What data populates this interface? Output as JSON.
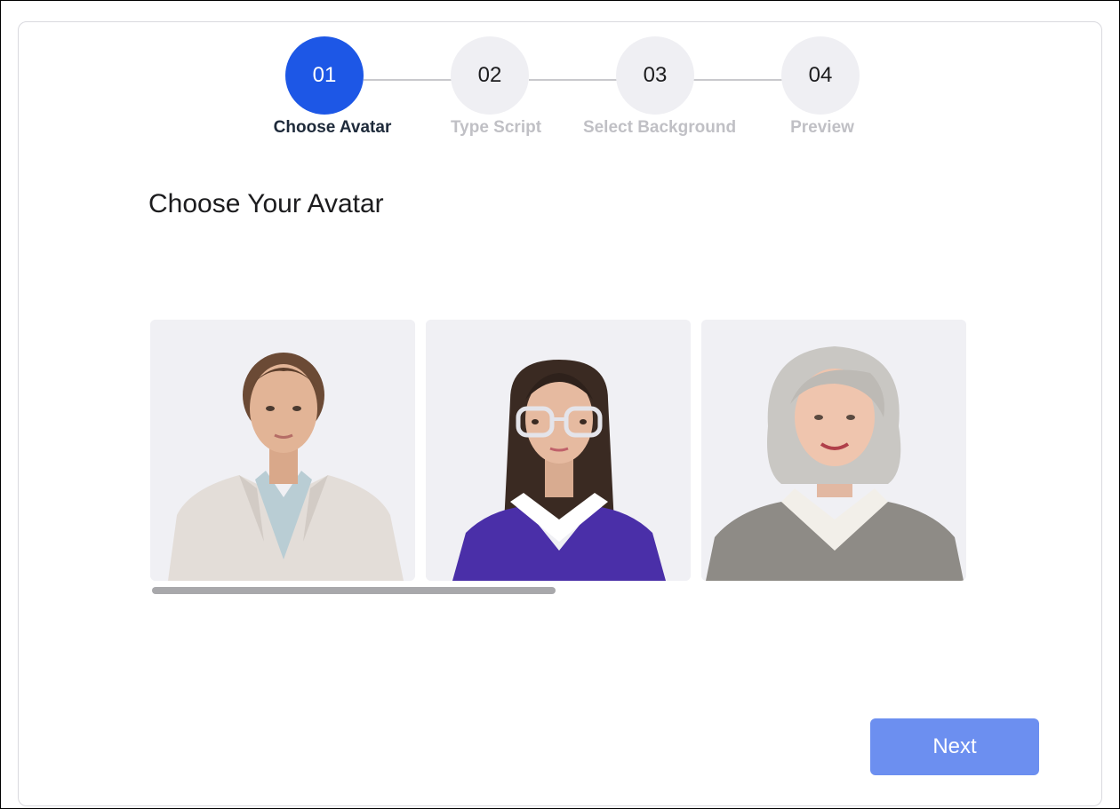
{
  "stepper": {
    "steps": [
      {
        "number": "01",
        "label": "Choose Avatar",
        "state": "active"
      },
      {
        "number": "02",
        "label": "Type Script",
        "state": "inactive"
      },
      {
        "number": "03",
        "label": "Select Background",
        "state": "inactive"
      },
      {
        "number": "04",
        "label": "Preview",
        "state": "inactive"
      }
    ]
  },
  "main": {
    "title": "Choose Your Avatar"
  },
  "carousel": {
    "avatars": [
      {
        "icon": "avatar-woman-blazer-photo"
      },
      {
        "icon": "avatar-woman-glasses-photo"
      },
      {
        "icon": "avatar-senior-woman-photo"
      }
    ],
    "scroll_progress": 0.5
  },
  "footer": {
    "next_label": "Next"
  },
  "colors": {
    "accent": "#1d57e6",
    "next_button": "#6c8ff0",
    "inactive_step": "#efeff3",
    "card_bg": "#f0f0f4"
  }
}
